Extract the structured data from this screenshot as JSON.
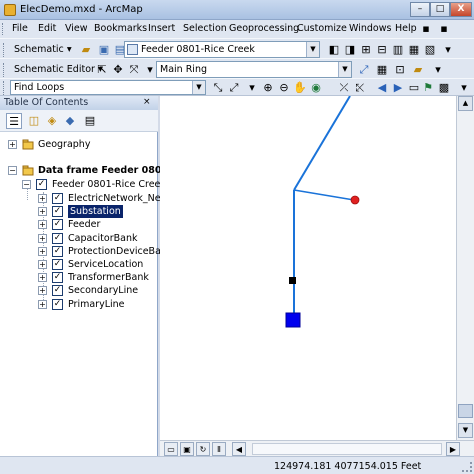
{
  "window": {
    "title": "ElecDemo.mxd - ArcMap",
    "minimize": "–",
    "maximize": "□",
    "close": "X"
  },
  "menu": [
    "File",
    "Edit",
    "View",
    "Bookmarks",
    "Insert",
    "Selection",
    "Geoprocessing",
    "Customize",
    "Windows",
    "Help"
  ],
  "toolbar1": {
    "schematic_label": "Schematic",
    "diagram_value": "Feeder 0801-Rice Creek"
  },
  "toolbar2": {
    "editor_label": "Schematic Editor",
    "layout_value": "Main Ring"
  },
  "toolbar3": {
    "find_value": "Find Loops"
  },
  "toc": {
    "title": "Table Of Contents",
    "groups": {
      "geography": "Geography",
      "data_frame": "Data frame Feeder 0801-I",
      "diagram_layer": "Feeder 0801-Rice Creek"
    },
    "layers": [
      "ElectricNetwork_Net_J",
      "Substation",
      "Feeder",
      "CapacitorBank",
      "ProtectionDeviceBank",
      "ServiceLocation",
      "TransformerBank",
      "SecondaryLine",
      "PrimaryLine"
    ]
  },
  "status": {
    "coordinates": "124974.181  4077154.015 Feet"
  },
  "colors": {
    "line": "#1a73d9",
    "substation": "#0000ee",
    "junction": "#000000",
    "endpoint": "#e02020",
    "selection": "#0a246a"
  }
}
